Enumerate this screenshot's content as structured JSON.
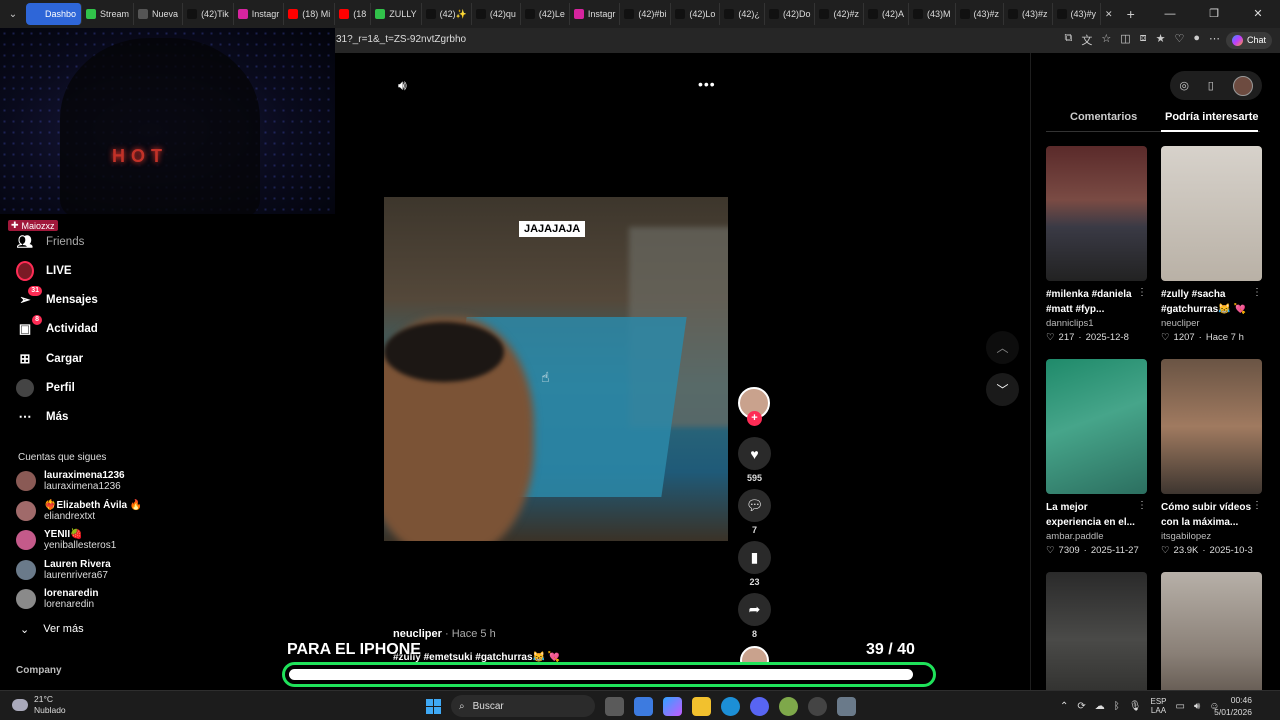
{
  "browser": {
    "tabs": [
      {
        "label": "Dashbo",
        "active": true,
        "color": "#2e66d8"
      },
      {
        "label": "Stream",
        "color": "#31c24a"
      },
      {
        "label": "Nueva",
        "color": "#555555"
      },
      {
        "label": "(42)Tik",
        "color": "#111111"
      },
      {
        "label": "Instagr",
        "color": "#d6249f"
      },
      {
        "label": "(18) Mi",
        "color": "#ff0000"
      },
      {
        "label": "(18",
        "color": "#ff0000"
      },
      {
        "label": "ZULLY",
        "color": "#31c24a"
      },
      {
        "label": "(42)✨",
        "color": "#111111"
      },
      {
        "label": "(42)qu",
        "color": "#111111"
      },
      {
        "label": "(42)Le",
        "color": "#111111"
      },
      {
        "label": "Instagr",
        "color": "#d6249f"
      },
      {
        "label": "(42)#bi",
        "color": "#111111"
      },
      {
        "label": "(42)Lo",
        "color": "#111111"
      },
      {
        "label": "(42)¿",
        "color": "#111111"
      },
      {
        "label": "(42)Do",
        "color": "#111111"
      },
      {
        "label": "(42)#z",
        "color": "#111111"
      },
      {
        "label": "(42)A",
        "color": "#111111"
      },
      {
        "label": "(43)M",
        "color": "#111111"
      },
      {
        "label": "(43)#z",
        "color": "#111111"
      },
      {
        "label": "(43)#z",
        "color": "#111111"
      },
      {
        "label": "(43)#y",
        "color": "#111111"
      }
    ],
    "url": "31?_r=1&_t=ZS-92nvtZgrbho",
    "chat_label": "Chat"
  },
  "webcam": {
    "sign_text": "HOT",
    "streamer_tag": "Maiozxz"
  },
  "sidebar": {
    "nav": [
      {
        "label": "Friends",
        "icon": "friends-icon"
      },
      {
        "label": "LIVE",
        "icon": "live-icon"
      },
      {
        "label": "Mensajes",
        "icon": "messages-icon",
        "badge": "31"
      },
      {
        "label": "Actividad",
        "icon": "activity-icon",
        "badge": "8"
      },
      {
        "label": "Cargar",
        "icon": "upload-icon"
      },
      {
        "label": "Perfil",
        "icon": "profile-icon"
      },
      {
        "label": "Más",
        "icon": "more-icon"
      }
    ],
    "following_title": "Cuentas que sigues",
    "following": [
      {
        "name": "lauraximena1236",
        "user": "lauraximena1236"
      },
      {
        "name": "❤️‍🔥Elizabeth Ávila 🔥",
        "user": "eliandrextxt"
      },
      {
        "name": "YENII🍓",
        "user": "yeniballesteros1"
      },
      {
        "name": "Lauren Rivera",
        "user": "laurenrivera67"
      },
      {
        "name": "lorenaredin",
        "user": "lorenaredin"
      }
    ],
    "see_more": "Ver más",
    "company": "Company"
  },
  "video": {
    "caption_overlay": "JAJAJAJA",
    "author": "neucliper",
    "time": "· Hace 5 h",
    "tags": "#zully #emetsuki #gatchurras😹 💘",
    "likes": "595",
    "comments": "7",
    "saves": "23",
    "shares": "8"
  },
  "stream_overlay": {
    "title": "PARA EL IPHONE",
    "current": "39",
    "total": "/ 40",
    "progress": 0.975,
    "accent": "#1fe25a"
  },
  "right_panel": {
    "tab_comments": "Comentarios",
    "tab_suggested": "Podría interesarte",
    "cards": [
      {
        "title": "#milenka #daniela #matt #fyp...",
        "user": "danniclips1",
        "likes": "217",
        "date": "2025-12-8"
      },
      {
        "title": "#zully #sacha #gatchurras😹 💘",
        "user": "neucliper",
        "likes": "1207",
        "date": "Hace 7 h"
      },
      {
        "title": "La mejor experiencia en el...",
        "user": "ambar.paddle",
        "likes": "7309",
        "date": "2025-11-27"
      },
      {
        "title": "Cómo subir vídeos con la máxima...",
        "user": "itsgabilopez",
        "likes": "23.9K",
        "date": "2025-10-3"
      },
      {
        "title": "",
        "user": "",
        "likes": "",
        "date": ""
      },
      {
        "title": "",
        "user": "",
        "likes": "",
        "date": ""
      }
    ]
  },
  "taskbar": {
    "temp": "21°C",
    "weather": "Nublado",
    "search": "Buscar",
    "lang1": "ESP",
    "lang2": "LAA",
    "time": "00:46",
    "date": "5/01/2026"
  }
}
